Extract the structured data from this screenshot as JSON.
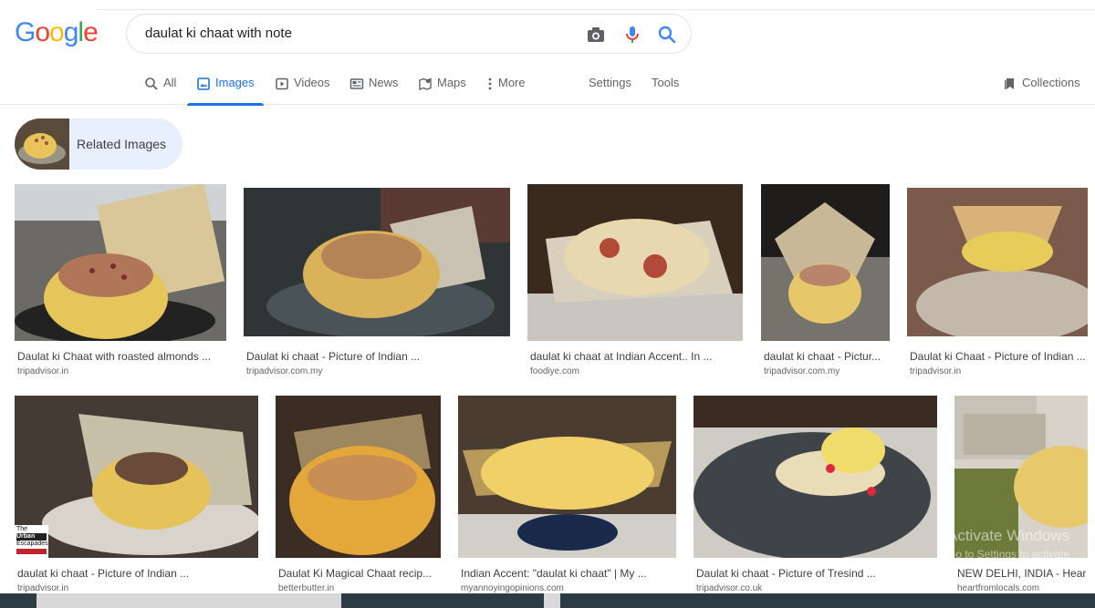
{
  "logo": {
    "text": "Google",
    "letters": [
      "G",
      "o",
      "o",
      "g",
      "l",
      "e"
    ],
    "colors": [
      "#4285f4",
      "#ea4335",
      "#fbbc05",
      "#4285f4",
      "#34a853",
      "#ea4335"
    ]
  },
  "search": {
    "query": "daulat ki chaat with note"
  },
  "tabs": [
    {
      "label": "All",
      "icon": "search-icon"
    },
    {
      "label": "Images",
      "icon": "image-icon",
      "active": true
    },
    {
      "label": "Videos",
      "icon": "play-icon"
    },
    {
      "label": "News",
      "icon": "news-icon"
    },
    {
      "label": "Maps",
      "icon": "map-icon"
    },
    {
      "label": "More",
      "icon": "kebab-icon"
    }
  ],
  "tools": {
    "settings": "Settings",
    "tools": "Tools",
    "collections": "Collections"
  },
  "related": {
    "label": "Related Images"
  },
  "results": [
    {
      "title": "Daulat ki Chaat with roasted almonds ...",
      "site": "tripadvisor.in"
    },
    {
      "title": "Daulat ki chaat - Picture of Indian ...",
      "site": "tripadvisor.com.my"
    },
    {
      "title": "daulat ki chaat at Indian Accent.. In ...",
      "site": "foodiye.com"
    },
    {
      "title": "daulat ki chaat - Pictur...",
      "site": "tripadvisor.com.my"
    },
    {
      "title": "Daulat ki Chaat - Picture of Indian ...",
      "site": "tripadvisor.in"
    },
    {
      "title": "daulat ki chaat - Picture of Indian ...",
      "site": "tripadvisor.in"
    },
    {
      "title": "Daulat Ki Magical Chaat recip...",
      "site": "betterbutter.in"
    },
    {
      "title": "Indian Accent: \"daulat ki chaat\" | My ...",
      "site": "myannoyingopinions.com"
    },
    {
      "title": "Daulat ki chaat - Picture of Tresind ...",
      "site": "tripadvisor.co.uk"
    },
    {
      "title": "NEW DELHI, INDIA - Hear",
      "site": "heartfromlocals.com"
    }
  ],
  "image_badge": {
    "line1": "The",
    "line2": "Urban",
    "line3": "Escapades"
  },
  "watermark": {
    "line1": "Activate Windows",
    "line2": "Go to Settings to activate"
  },
  "colors": {
    "accent": "#1a73e8",
    "related_bg": "#e8f0fe"
  }
}
